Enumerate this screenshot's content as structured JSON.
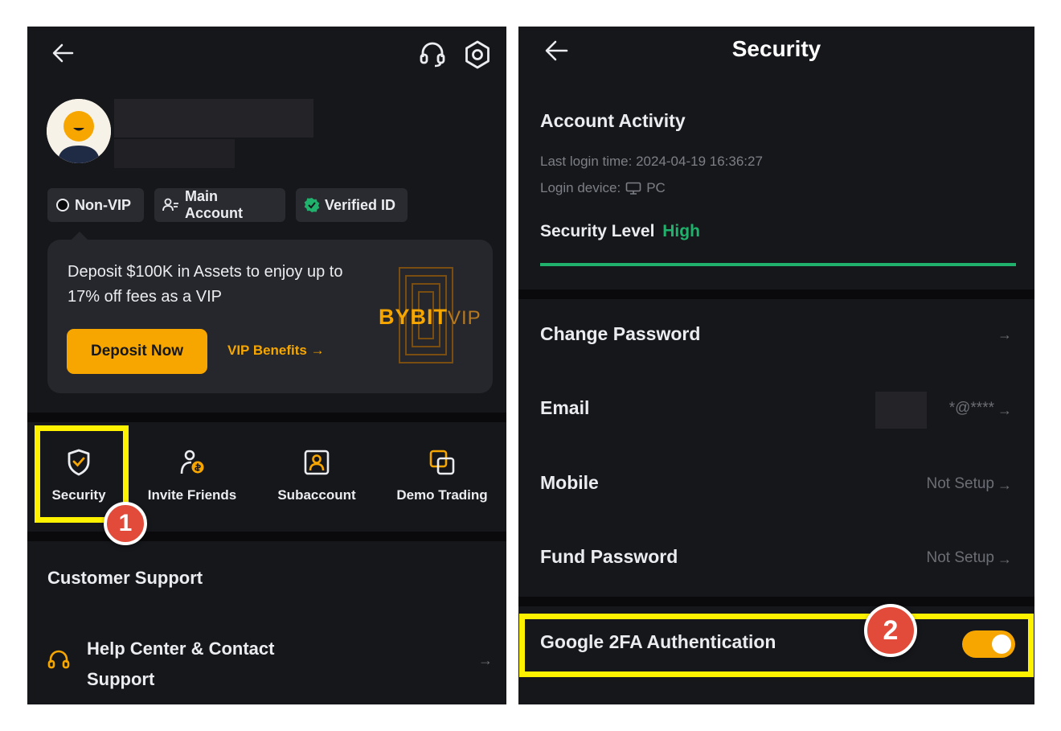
{
  "left": {
    "badges": [
      "Non-VIP",
      "Main Account",
      "Verified ID"
    ],
    "promo_text": "Deposit $100K in Assets to enjoy up to 17% off fees as a VIP",
    "deposit_button": "Deposit Now",
    "vip_benefits": "VIP Benefits",
    "bybit_logo": "BYBIT",
    "bybit_vip": "VIP",
    "quick_actions": [
      "Security",
      "Invite Friends",
      "Subaccount",
      "Demo Trading"
    ],
    "step1": "1",
    "customer_support_title": "Customer Support",
    "help_center_line1": "Help Center & Contact",
    "help_center_line2": "Support"
  },
  "right": {
    "title": "Security",
    "account_activity": "Account Activity",
    "last_login_label": "Last login time:",
    "last_login_value": "2024-04-19 16:36:27",
    "login_device_label": "Login device:",
    "login_device_value": "PC",
    "security_level_label": "Security Level",
    "security_level_value": "High",
    "security_level_fraction": 1.0,
    "rows": [
      {
        "label": "Change Password",
        "value": ""
      },
      {
        "label": "Email",
        "value": "*@****"
      },
      {
        "label": "Mobile",
        "value": "Not Setup"
      },
      {
        "label": "Fund Password",
        "value": "Not Setup"
      }
    ],
    "google_2fa": "Google 2FA Authentication",
    "google_2fa_enabled": true,
    "step2": "2"
  },
  "colors": {
    "accent": "#f7a600",
    "highlight": "#fff200",
    "success": "#20b26c",
    "step_badge": "#e24b39",
    "background": "#16171b"
  }
}
